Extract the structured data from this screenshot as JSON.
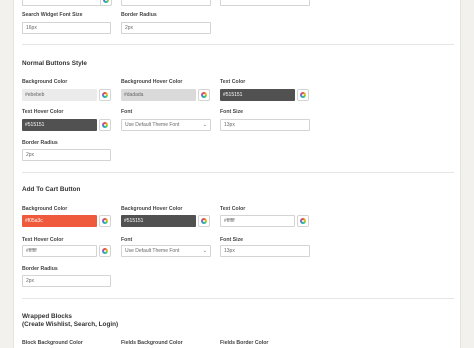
{
  "colors": {
    "page_bg": "#f3f1ee",
    "panel_bg": "#ffffff",
    "field_border": "#d4d4d4",
    "normal_bg": "#ebebeb",
    "normal_hover_bg": "#dadada",
    "dark_text": "#515151",
    "cart_bg": "#f05a3c",
    "cart_hover_bg": "#515151"
  },
  "top": {
    "search_font_size_label": "Search Widget Font Size",
    "search_font_size_value": "16px",
    "border_radius_label": "Border Radius",
    "border_radius_value": "2px"
  },
  "normal": {
    "title": "Normal Buttons Style",
    "bg_label": "Background Color",
    "bg_value": "#ebebeb",
    "hover_bg_label": "Background Hover Color",
    "hover_bg_value": "#dadada",
    "text_label": "Text Color",
    "text_value": "#515151",
    "text_hover_label": "Text Hover Color",
    "text_hover_value": "#515151",
    "font_label": "Font",
    "font_value": "Use Default Theme Font",
    "font_size_label": "Font Size",
    "font_size_value": "13px",
    "radius_label": "Border Radius",
    "radius_value": "2px"
  },
  "cart": {
    "title": "Add To Cart Button",
    "bg_label": "Background Color",
    "bg_value": "#f05a3c",
    "hover_bg_label": "Background Hover Color",
    "hover_bg_value": "#515151",
    "text_label": "Text Color",
    "text_value": "#ffffff",
    "text_hover_label": "Text Hover Color",
    "text_hover_value": "#ffffff",
    "font_label": "Font",
    "font_value": "Use Default Theme Font",
    "font_size_label": "Font Size",
    "font_size_value": "13px",
    "radius_label": "Border Radius",
    "radius_value": "2px"
  },
  "wrapped": {
    "title_line1": "Wrapped Blocks",
    "title_line2": "(Create Wishlist, Search, Login)",
    "block_bg_label": "Block Background Color",
    "fields_bg_label": "Fields Background Color",
    "fields_border_label": "Fields Border Color"
  },
  "icons": {
    "picker": "color-wheel-icon",
    "dropdown": "chevron-down-icon"
  }
}
